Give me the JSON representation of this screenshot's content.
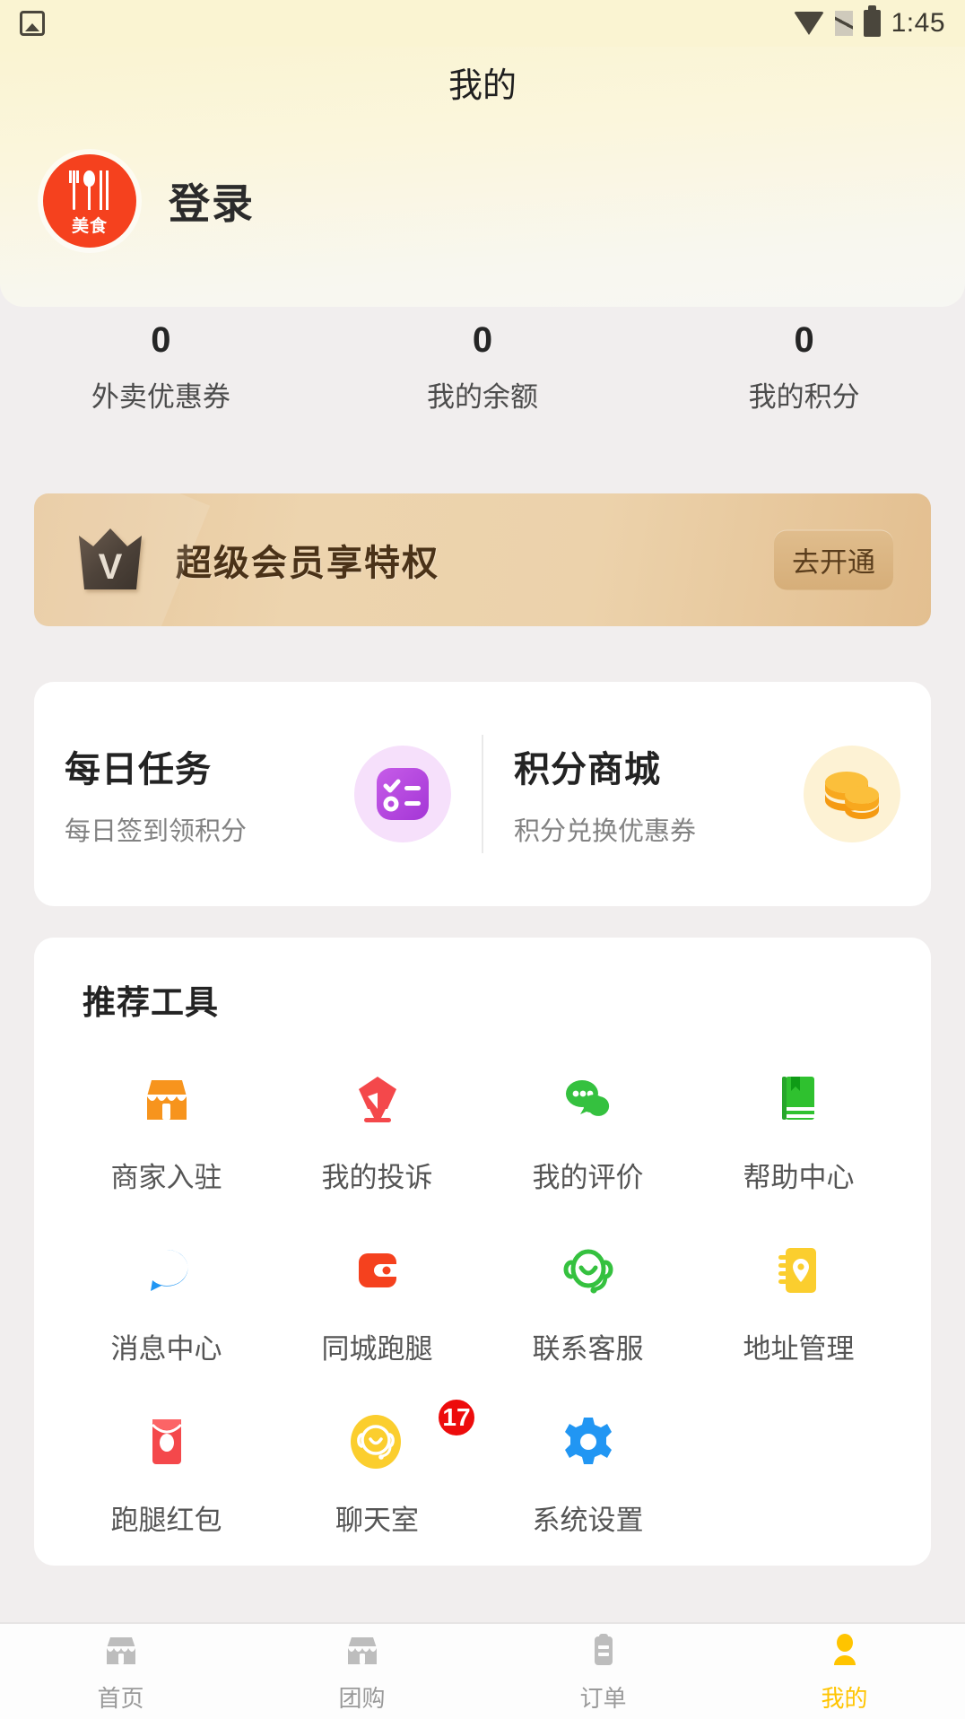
{
  "statusbar": {
    "photo_icon": "photo-icon",
    "wifi_icon": "wifi-icon",
    "signal_icon": "signal-off-icon",
    "battery_icon": "battery-icon",
    "time": "1:45"
  },
  "header": {
    "title": "我的",
    "avatar_icon": "cutlery-logo-icon",
    "avatar_word": "美食",
    "login_label": "登录"
  },
  "stats": [
    {
      "value": "0",
      "label": "外卖优惠券"
    },
    {
      "value": "0",
      "label": "我的余额"
    },
    {
      "value": "0",
      "label": "我的积分"
    }
  ],
  "vip": {
    "crown_icon": "crown-v-icon",
    "text": "超级会员享特权",
    "button_label": "去开通"
  },
  "entries": [
    {
      "title": "每日任务",
      "subtitle": "每日签到领积分",
      "icon": "checklist-icon",
      "icon_color": "#b44ce0"
    },
    {
      "title": "积分商城",
      "subtitle": "积分兑换优惠券",
      "icon": "gold-coins-icon",
      "icon_color": "#f5a623"
    }
  ],
  "tools": {
    "title": "推荐工具",
    "items": [
      {
        "label": "商家入驻",
        "icon": "shop-icon",
        "color": "#f7941d",
        "badge": ""
      },
      {
        "label": "我的投诉",
        "icon": "pen-nib-icon",
        "color": "#f4484b",
        "badge": ""
      },
      {
        "label": "我的评价",
        "icon": "chat-bubbles-icon",
        "color": "#35c13f",
        "badge": ""
      },
      {
        "label": "帮助中心",
        "icon": "book-icon",
        "color": "#2fc12f",
        "badge": ""
      },
      {
        "label": "消息中心",
        "icon": "message-bubble-icon",
        "color": "#2196f3",
        "badge": ""
      },
      {
        "label": "同城跑腿",
        "icon": "wallet-icon",
        "color": "#f5411e",
        "badge": ""
      },
      {
        "label": "联系客服",
        "icon": "headset-support-icon",
        "color": "#35c13f",
        "badge": ""
      },
      {
        "label": "地址管理",
        "icon": "address-book-icon",
        "color": "#fbce2e",
        "badge": ""
      },
      {
        "label": "跑腿红包",
        "icon": "red-envelope-icon",
        "color": "#f4484b",
        "badge": ""
      },
      {
        "label": "聊天室",
        "icon": "chat-room-icon",
        "color": "#fbce2e",
        "badge": "17"
      },
      {
        "label": "系统设置",
        "icon": "gear-icon",
        "color": "#2196f3",
        "badge": ""
      }
    ]
  },
  "tabbar": {
    "items": [
      {
        "label": "首页",
        "icon": "shop-icon",
        "active": false
      },
      {
        "label": "团购",
        "icon": "shop-icon",
        "active": false
      },
      {
        "label": "订单",
        "icon": "clipboard-icon",
        "active": false
      },
      {
        "label": "我的",
        "icon": "person-icon",
        "active": true
      }
    ],
    "active_color": "#ffc400",
    "inactive_color": "#bdbdbd"
  }
}
